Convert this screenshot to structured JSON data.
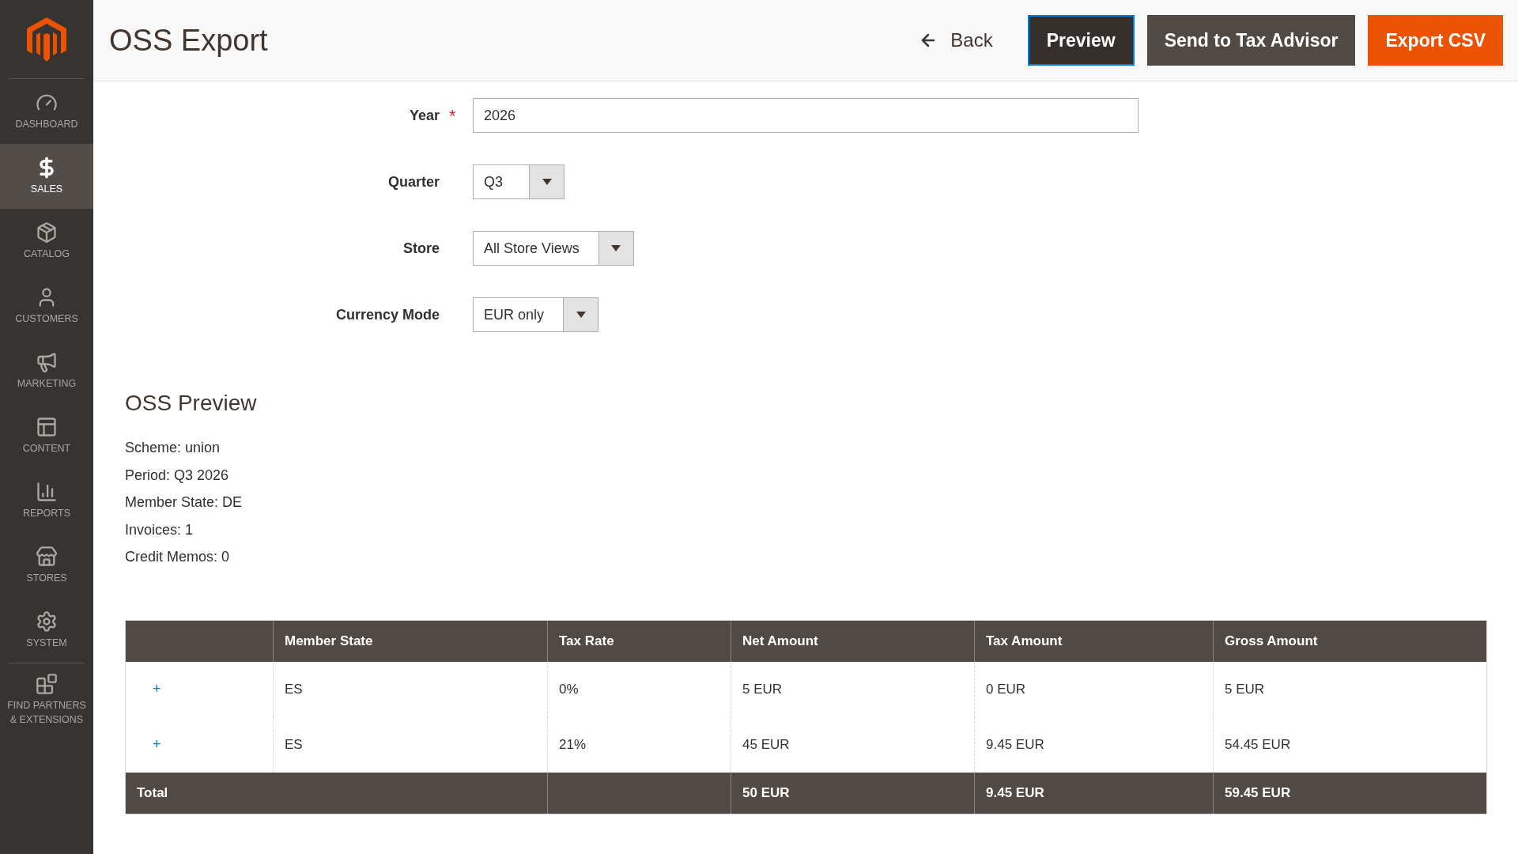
{
  "sidebar": {
    "items": [
      {
        "kind": "dashboard",
        "label": "DASHBOARD",
        "selected": false
      },
      {
        "kind": "sales",
        "label": "SALES",
        "selected": true
      },
      {
        "kind": "catalog",
        "label": "CATALOG",
        "selected": false
      },
      {
        "kind": "customers",
        "label": "CUSTOMERS",
        "selected": false
      },
      {
        "kind": "marketing",
        "label": "MARKETING",
        "selected": false
      },
      {
        "kind": "content",
        "label": "CONTENT",
        "selected": false
      },
      {
        "kind": "reports",
        "label": "REPORTS",
        "selected": false
      },
      {
        "kind": "stores",
        "label": "STORES",
        "selected": false
      },
      {
        "kind": "system",
        "label": "SYSTEM",
        "selected": false
      },
      {
        "kind": "partners",
        "label": "FIND PARTNERS & EXTENSIONS",
        "selected": false
      }
    ]
  },
  "page": {
    "title": "OSS Export"
  },
  "actions": [
    {
      "kind": "back",
      "label": "Back"
    },
    {
      "kind": "dark",
      "label": "Preview"
    },
    {
      "kind": "secondary",
      "label": "Send to Tax Advisor"
    },
    {
      "kind": "primary",
      "label": "Export CSV"
    }
  ],
  "form": {
    "fields": [
      {
        "kind": "input",
        "label": "Year",
        "required": true,
        "required_marker": "*",
        "value": "2026"
      },
      {
        "kind": "select",
        "label": "Quarter",
        "required": false,
        "value": "Q3"
      },
      {
        "kind": "select",
        "label": "Store",
        "required": false,
        "value": "All Store Views"
      },
      {
        "kind": "select",
        "label": "Currency Mode",
        "required": false,
        "value": "EUR only"
      }
    ]
  },
  "preview": {
    "title": "OSS Preview",
    "summary": [
      "Scheme: union",
      "Period: Q3 2026",
      "Member State: DE",
      "Invoices: 1",
      "Credit Memos: 0"
    ]
  },
  "table": {
    "columns": [
      "",
      "Member State",
      "Tax Rate",
      "Net Amount",
      "Tax Amount",
      "Gross Amount"
    ],
    "rows": [
      {
        "cells": [
          "+",
          "ES",
          "0%",
          "5 EUR",
          "0 EUR",
          "5 EUR"
        ]
      },
      {
        "cells": [
          "+",
          "ES",
          "21%",
          "45 EUR",
          "9.45 EUR",
          "54.45 EUR"
        ]
      }
    ],
    "total": {
      "label": "Total",
      "cells": [
        "",
        "50 EUR",
        "9.45 EUR",
        "59.45 EUR"
      ]
    }
  }
}
